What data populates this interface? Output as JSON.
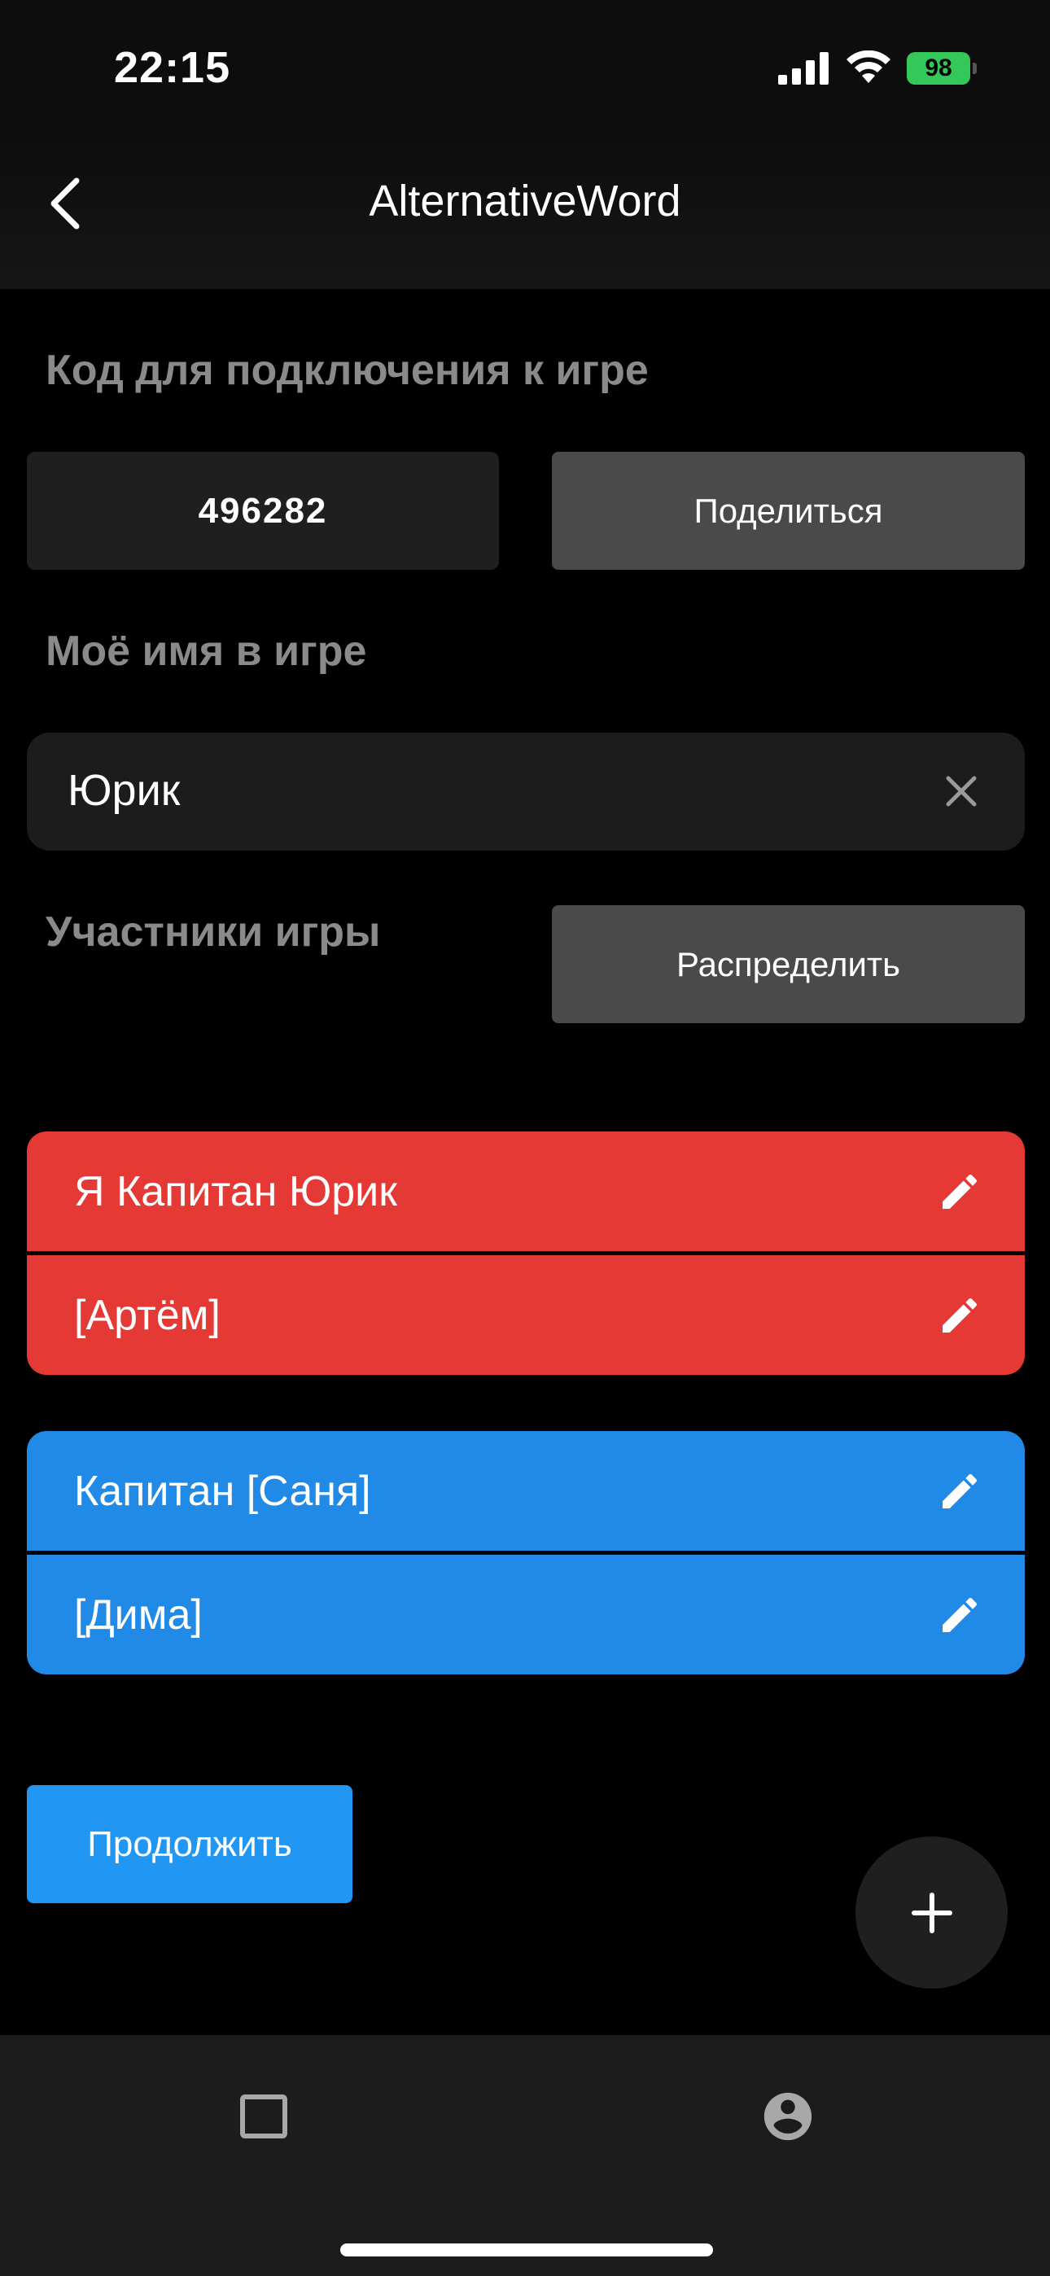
{
  "status_bar": {
    "time": "22:15",
    "battery": "98"
  },
  "nav": {
    "title": "AlternativeWord",
    "back_icon": "chevron-left-icon"
  },
  "code_section": {
    "label": "Код для подключения к игре",
    "code": "496282",
    "share_label": "Поделиться"
  },
  "name_section": {
    "label": "Моё имя в игре",
    "value": "Юрик",
    "clear_icon": "close-icon"
  },
  "players_section": {
    "label": "Участники игры",
    "distribute_label": "Распределить"
  },
  "teams": [
    {
      "color": "#e53935",
      "players": [
        "Я Капитан Юрик",
        "[Артём]"
      ]
    },
    {
      "color": "#2189e6",
      "players": [
        "Капитан [Саня]",
        "[Дима]"
      ]
    }
  ],
  "actions": {
    "continue_label": "Продолжить",
    "fab_icon": "plus-icon"
  },
  "tab_bar": {
    "items": [
      {
        "icon": "square-icon"
      },
      {
        "icon": "account-circle-icon"
      }
    ]
  }
}
